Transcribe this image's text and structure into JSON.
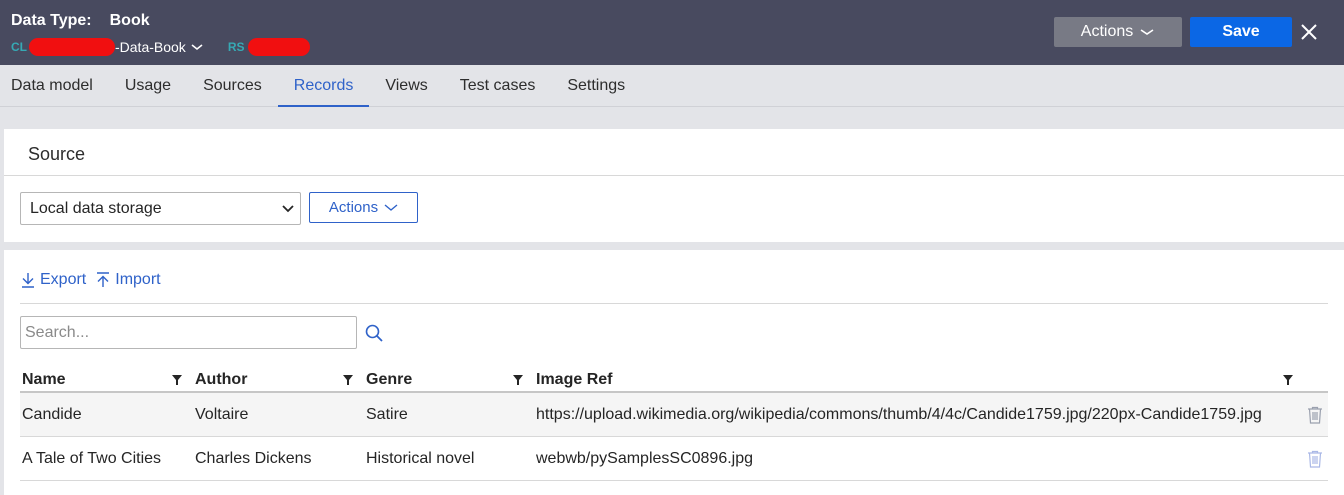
{
  "header": {
    "type_label": "Data Type:",
    "type_value": "Book",
    "class_key": "CL",
    "class_value": "-Data-Book",
    "ruleset_key": "RS",
    "actions_label": "Actions",
    "save_label": "Save"
  },
  "tabs": [
    {
      "label": "Data model"
    },
    {
      "label": "Usage"
    },
    {
      "label": "Sources"
    },
    {
      "label": "Records"
    },
    {
      "label": "Views"
    },
    {
      "label": "Test cases"
    },
    {
      "label": "Settings"
    }
  ],
  "active_tab": "Records",
  "source": {
    "title": "Source",
    "selected": "Local data storage",
    "actions_label": "Actions"
  },
  "records": {
    "export_label": "Export",
    "import_label": "Import",
    "search_placeholder": "Search...",
    "columns": [
      "Name",
      "Author",
      "Genre",
      "Image Ref"
    ],
    "rows": [
      [
        "Candide",
        "Voltaire",
        "Satire",
        "https://upload.wikimedia.org/wikipedia/commons/thumb/4/4c/Candide1759.jpg/220px-Candide1759.jpg"
      ],
      [
        "A Tale of Two Cities",
        "Charles Dickens",
        "Historical novel",
        "webwb/pySamplesSC0896.jpg"
      ]
    ]
  },
  "colors": {
    "header_bg": "#484a5f",
    "accent": "#2f62c9",
    "save_bg": "#0b67e5",
    "redaction": "#f10f10"
  }
}
